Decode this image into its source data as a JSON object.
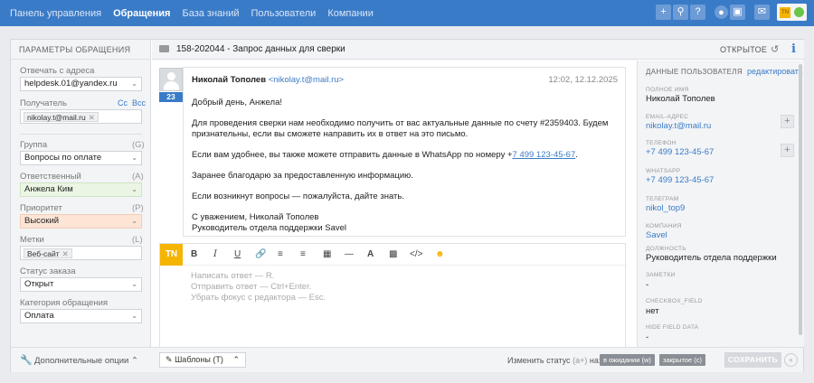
{
  "nav": {
    "items": [
      "Панель управления",
      "Обращения",
      "База знаний",
      "Пользователи",
      "Компании"
    ],
    "active_index": 1
  },
  "top_icons": [
    "plus-icon",
    "search-icon",
    "help-icon",
    "chat-icon",
    "inbox-icon",
    "mail-icon"
  ],
  "user_badge": {
    "initials": "TN",
    "status_color": "#6cc44a"
  },
  "left_panel": {
    "header": "ПАРАМЕТРЫ ОБРАЩЕНИЯ",
    "reply_from_label": "Отвечать с адреса",
    "reply_from_value": "helpdesk.01@yandex.ru",
    "recipient_label": "Получатель",
    "cc": "Cc",
    "bcc": "Bcc",
    "recipient_token": "nikolay.t@mail.ru",
    "group_label": "Группа",
    "group_hotkey": "(G)",
    "group_value": "Вопросы по оплате",
    "assignee_label": "Ответственный",
    "assignee_hotkey": "(A)",
    "assignee_value": "Анжела Ким",
    "priority_label": "Приоритет",
    "priority_hotkey": "(P)",
    "priority_value": "Высокий",
    "tags_label": "Метки",
    "tags_hotkey": "(L)",
    "tag_token": "Веб-сайт",
    "order_status_label": "Статус заказа",
    "order_status_value": "Открыт",
    "category_label": "Категория обращения",
    "category_value": "Оплата"
  },
  "ticket": {
    "subject": "158-202044 - Запрос данных для сверки",
    "status": "ОТКРЫТОЕ"
  },
  "message": {
    "number": "23",
    "sender_name": "Николай Тополев",
    "sender_email": "<nikolay.t@mail.ru>",
    "date": "12:02, 12.12.2025",
    "greeting": "Добрый день, Анжела!",
    "p1": "Для проведения сверки нам необходимо получить от вас актуальные данные по счету #2359403. Будем признательны, если вы сможете направить их в ответ на это письмо.",
    "p2_prefix": "Если вам удобнее, вы также можете отправить данные в WhatsApp по номеру +",
    "p2_link": "7 499 123-45-67",
    "p2_suffix": ".",
    "p3": "Заранее благодарю за предоставленную информацию.",
    "p4": "Если возникнут вопросы — пожалуйста, дайте знать.",
    "sign1": "С уважением, Николай Тополев",
    "sign2": "Руководитель отдела поддержки Savel"
  },
  "editor": {
    "badge": "TN",
    "hint1": "Написать ответ — R.",
    "hint2": "Отправить ответ — Ctrl+Enter.",
    "hint3": "Убрать фокус с редактора — Esc."
  },
  "right_panel": {
    "header": "ДАННЫЕ ПОЛЬЗОВАТЕЛЯ",
    "edit": "редактировать",
    "fields": [
      {
        "label": "ПОЛНОЕ ИМЯ",
        "value": "Николай Тополев"
      },
      {
        "label": "EMAIL-АДРЕС",
        "value": "nikolay.t@mail.ru"
      },
      {
        "label": "ТЕЛЕФОН",
        "value": "+7 499 123-45-67"
      },
      {
        "label": "WHATSAPP",
        "value": "+7 499 123-45-67"
      },
      {
        "label": "ТЕЛЕГРАМ",
        "value": "nikol_top9"
      },
      {
        "label": "КОМПАНИЯ",
        "value": "Savel"
      },
      {
        "label": "ДОЛЖНОСТЬ",
        "value": "Руководитель отдела поддержки"
      },
      {
        "label": "ЗАМЕТКИ",
        "value": "-"
      },
      {
        "label": "CHECKBOX_FIELD",
        "value": "нет"
      },
      {
        "label": "HIDE FIELD DATA",
        "value": "-"
      }
    ]
  },
  "bottom": {
    "additional_options": "Дополнительные опции",
    "templates": "Шаблоны (T)",
    "change_status": "Изменить статус",
    "change_status_hotkey": "(a+)",
    "change_status_suffix": "на:",
    "status_waiting": "в ожидании (w)",
    "status_closed": "закрытое (c)",
    "save": "СОХРАНИТЬ"
  }
}
